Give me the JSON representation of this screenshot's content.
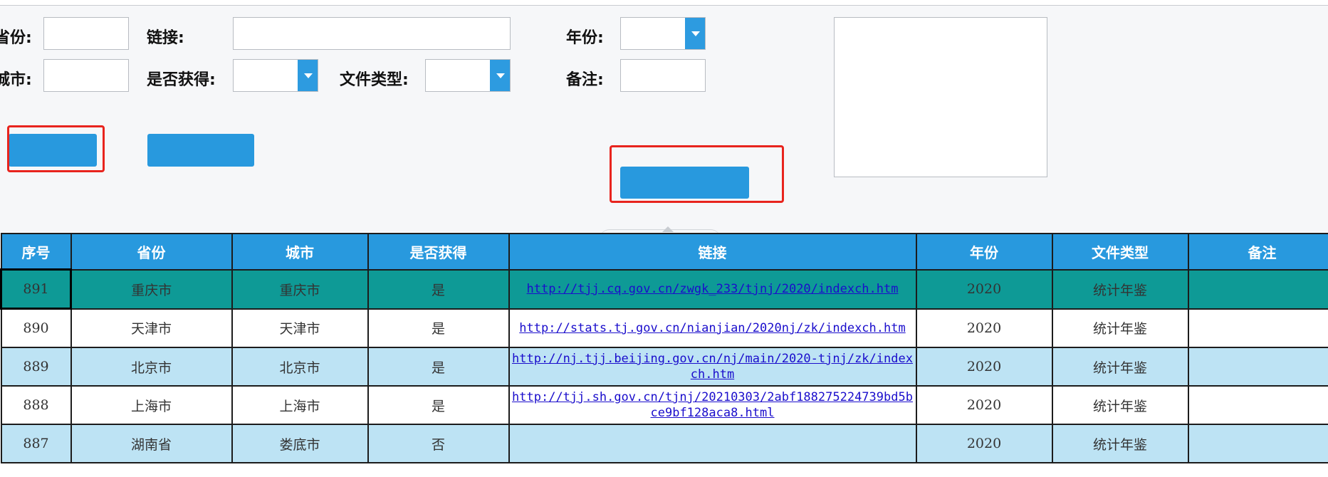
{
  "form": {
    "province_label": "省份:",
    "city_label": "城市:",
    "link_label": "链接:",
    "obtained_label": "是否获得:",
    "filetype_label": "文件类型:",
    "year_label": "年份:",
    "note_label": "备注:",
    "province_value": "",
    "city_value": "",
    "link_value": "",
    "obtained_value": "",
    "filetype_value": "",
    "year_value": "",
    "note_value": ""
  },
  "buttons": {
    "btn1_label": "",
    "btn2_label": "",
    "btn3_label": ""
  },
  "table": {
    "headers": [
      "序号",
      "省份",
      "城市",
      "是否获得",
      "链接",
      "年份",
      "文件类型",
      "备注"
    ],
    "rows": [
      {
        "id": "891",
        "province": "重庆市",
        "city": "重庆市",
        "obtained": "是",
        "link": "http://tjj.cq.gov.cn/zwgk_233/tjnj/2020/indexch.htm",
        "year": "2020",
        "type": "统计年鉴",
        "note": ""
      },
      {
        "id": "890",
        "province": "天津市",
        "city": "天津市",
        "obtained": "是",
        "link": "http://stats.tj.gov.cn/nianjian/2020nj/zk/indexch.htm",
        "year": "2020",
        "type": "统计年鉴",
        "note": ""
      },
      {
        "id": "889",
        "province": "北京市",
        "city": "北京市",
        "obtained": "是",
        "link": "http://nj.tjj.beijing.gov.cn/nj/main/2020-tjnj/zk/indexch.htm",
        "year": "2020",
        "type": "统计年鉴",
        "note": ""
      },
      {
        "id": "888",
        "province": "上海市",
        "city": "上海市",
        "obtained": "是",
        "link": "http://tjj.sh.gov.cn/tjnj/20210303/2abf188275224739bd5bce9bf128aca8.html",
        "year": "2020",
        "type": "统计年鉴",
        "note": ""
      },
      {
        "id": "887",
        "province": "湖南省",
        "city": "娄底市",
        "obtained": "否",
        "link": "",
        "year": "2020",
        "type": "统计年鉴",
        "note": ""
      }
    ]
  },
  "colors": {
    "header_bg": "#2899de",
    "selected_row_bg": "#0e9a96",
    "stripe_bg": "#bde3f4",
    "plain_bg": "#ffffff",
    "highlight_border": "#e8241e"
  }
}
